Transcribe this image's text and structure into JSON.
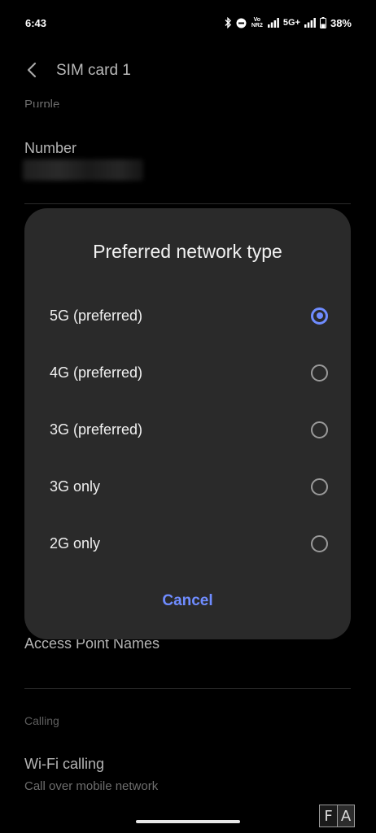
{
  "status_bar": {
    "time": "6:43",
    "network_label": "5G+",
    "volte_label": "Vo NR2",
    "battery_percent": "38%",
    "icons": [
      "bluetooth-icon",
      "dnd-icon",
      "volte-icon",
      "signal-icon",
      "5g-icon",
      "signal-icon",
      "battery-icon"
    ]
  },
  "app_bar": {
    "title": "SIM card 1",
    "back_icon": "chevron-left-icon"
  },
  "background": {
    "clipped_item_text": "Purple",
    "number_title": "Number",
    "access_point_title": "Access Point Names",
    "calling_section": "Calling",
    "wifi_calling_title": "Wi-Fi calling",
    "wifi_calling_sub": "Call over mobile network"
  },
  "dialog": {
    "title": "Preferred network type",
    "options": [
      {
        "label": "5G (preferred)",
        "selected": true
      },
      {
        "label": "4G (preferred)",
        "selected": false
      },
      {
        "label": "3G (preferred)",
        "selected": false
      },
      {
        "label": "3G only",
        "selected": false
      },
      {
        "label": "2G only",
        "selected": false
      }
    ],
    "cancel_label": "Cancel"
  },
  "watermark": {
    "left": "F",
    "right": "A"
  },
  "colors": {
    "accent": "#6f8cff",
    "dialog_bg": "#2a2a2a",
    "background": "#000000"
  }
}
